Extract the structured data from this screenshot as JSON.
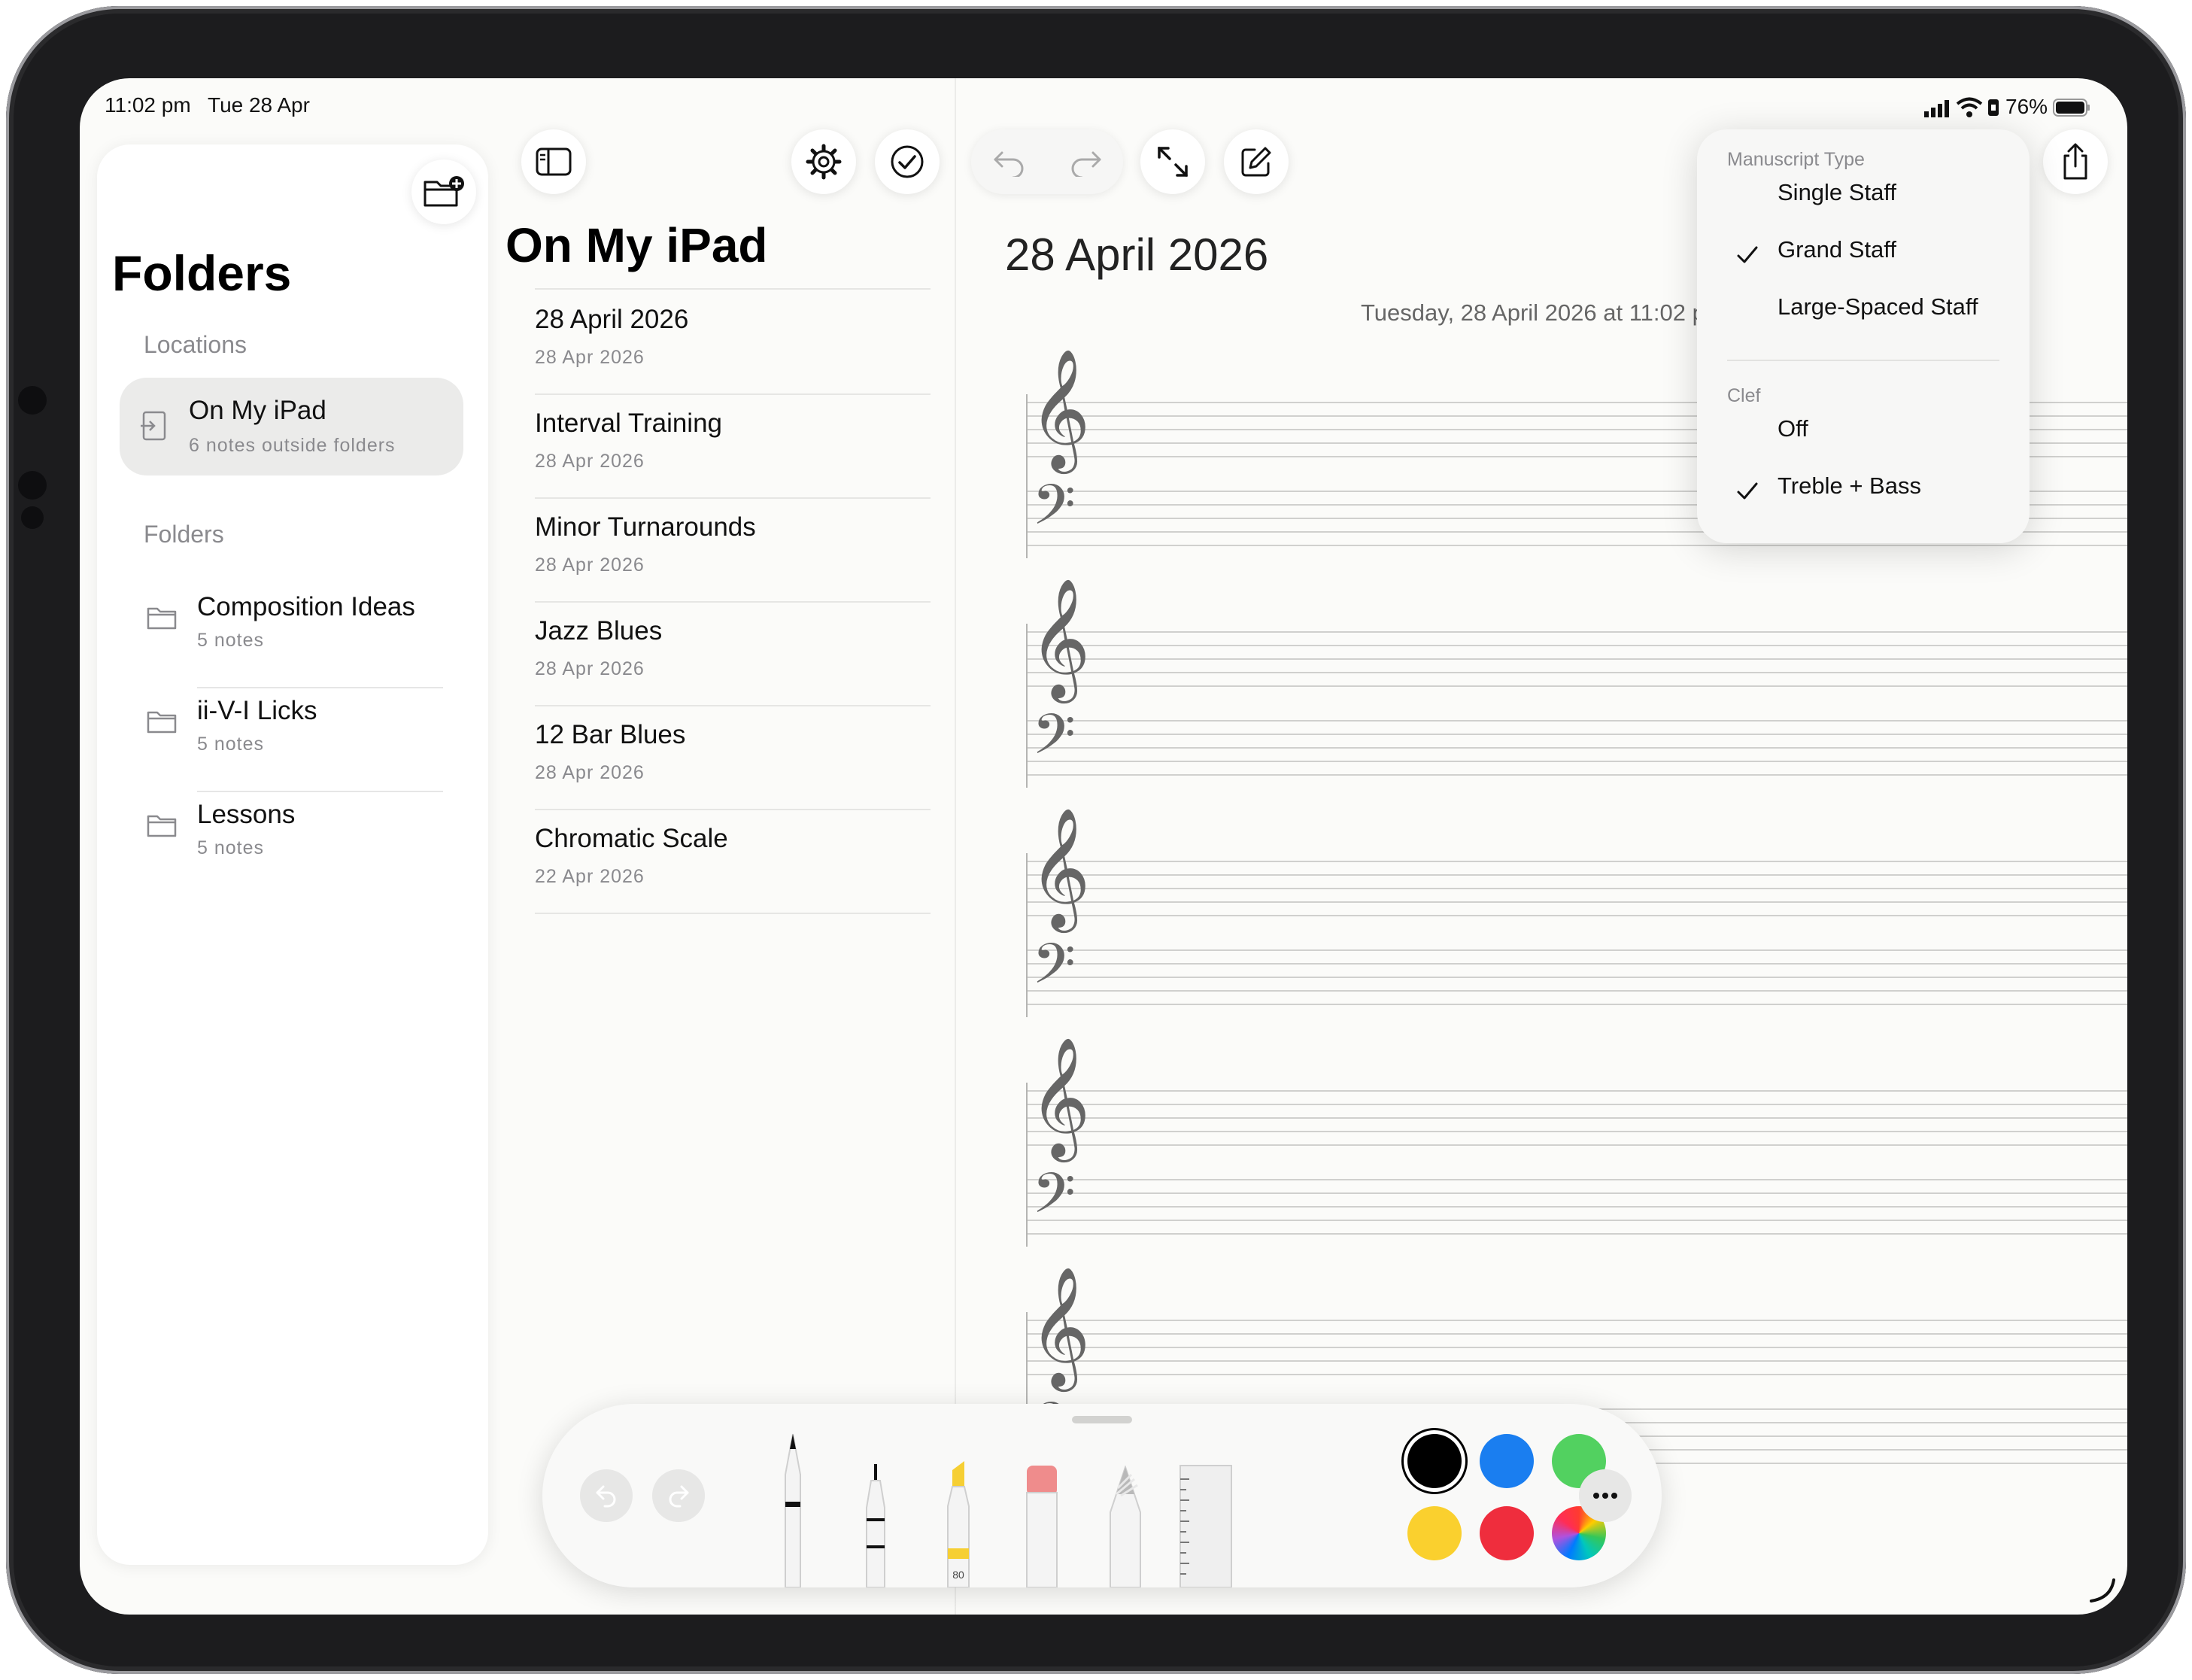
{
  "status_bar": {
    "time": "11:02 pm",
    "date": "Tue 28 Apr",
    "battery": "76%",
    "battery_level": 0.76
  },
  "sidebar": {
    "title": "Folders",
    "locations_label": "Locations",
    "location": {
      "name": "On My iPad",
      "subtitle": "6 notes outside folders"
    },
    "folders_label": "Folders",
    "folders": [
      {
        "name": "Composition Ideas",
        "count": "5 notes"
      },
      {
        "name": "ii-V-I Licks",
        "count": "5 notes"
      },
      {
        "name": "Lessons",
        "count": "5 notes"
      }
    ]
  },
  "note_list": {
    "title": "On My iPad",
    "notes": [
      {
        "title": "28 April 2026",
        "date": "28 Apr 2026"
      },
      {
        "title": "Interval Training",
        "date": "28 Apr 2026"
      },
      {
        "title": "Minor Turnarounds",
        "date": "28 Apr 2026"
      },
      {
        "title": "Jazz Blues",
        "date": "28 Apr 2026"
      },
      {
        "title": "12 Bar Blues",
        "date": "28 Apr 2026"
      },
      {
        "title": "Chromatic Scale",
        "date": "22 Apr 2026"
      }
    ]
  },
  "editor": {
    "title": "28 April 2026",
    "timestamp": "Tuesday, 28 April 2026 at 11:02 p"
  },
  "manuscript_menu": {
    "type_header": "Manuscript Type",
    "types": [
      {
        "label": "Single Staff",
        "checked": false
      },
      {
        "label": "Grand Staff",
        "checked": true
      },
      {
        "label": "Large-Spaced Staff",
        "checked": false
      }
    ],
    "clef_header": "Clef",
    "clefs": [
      {
        "label": "Off",
        "checked": false
      },
      {
        "label": "Treble + Bass",
        "checked": true
      }
    ]
  },
  "drawing_toolbar": {
    "marker_width": "80",
    "colors": [
      "#000000",
      "#1a7ef0",
      "#52d160",
      "#fad02e",
      "#ef2d3d",
      "rainbow"
    ],
    "selected_color": "#000000",
    "icons": [
      "undo-icon",
      "redo-icon",
      "pen-icon",
      "fineliner-icon",
      "highlighter-icon",
      "eraser-icon",
      "pencil-icon",
      "ruler-icon",
      "more-icon"
    ]
  }
}
